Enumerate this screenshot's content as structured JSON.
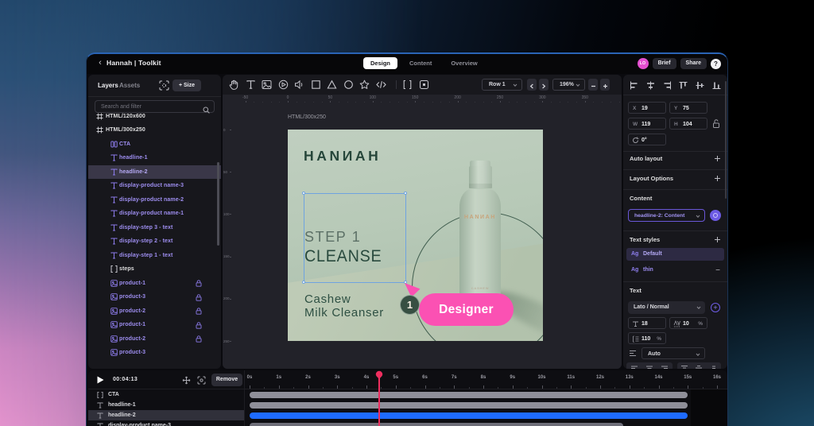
{
  "colors": {
    "accent_purple": "#8b7ae8",
    "accent_blue": "#1e6bff",
    "pink": "#fb51b3",
    "selection_blue": "#6fa3e0",
    "playhead_red": "#ee2e5f",
    "artboard_sage": "#b6c7b6",
    "deep_green": "#27473b",
    "avatar_pink": "#e44fd0"
  },
  "header": {
    "back": "‹",
    "title": "Hannah | Toolkit",
    "tabs": [
      {
        "label": "Design",
        "active": true
      },
      {
        "label": "Content",
        "active": false
      },
      {
        "label": "Overview",
        "active": false
      }
    ],
    "avatar": "LO",
    "brief": "Brief",
    "share": "Share",
    "help": "?"
  },
  "sidebar": {
    "tab_layers": "Layers",
    "tab_assets": "Assets",
    "size_button": "+ Size",
    "search_placeholder": "Search and filter",
    "layers": [
      {
        "name": "HTML/120x600",
        "icon": "frame",
        "tone": "white",
        "indent": 0,
        "selected": false,
        "locked": false
      },
      {
        "name": "HTML/300x250",
        "icon": "frame",
        "tone": "white",
        "indent": 0,
        "selected": false,
        "locked": false
      },
      {
        "name": "CTA",
        "icon": "component",
        "tone": "purple",
        "indent": 1,
        "selected": false,
        "locked": false
      },
      {
        "name": "headline-1",
        "icon": "text",
        "tone": "purple",
        "indent": 1,
        "selected": false,
        "locked": false
      },
      {
        "name": "headline-2",
        "icon": "text",
        "tone": "purple",
        "indent": 1,
        "selected": true,
        "locked": false
      },
      {
        "name": "display-product name-3",
        "icon": "text",
        "tone": "purple",
        "indent": 1,
        "selected": false,
        "locked": false
      },
      {
        "name": "display-product name-2",
        "icon": "text",
        "tone": "purple",
        "indent": 1,
        "selected": false,
        "locked": false
      },
      {
        "name": "display-product name-1",
        "icon": "text",
        "tone": "purple",
        "indent": 1,
        "selected": false,
        "locked": false
      },
      {
        "name": "display-step 3 - text",
        "icon": "text",
        "tone": "purple",
        "indent": 1,
        "selected": false,
        "locked": false
      },
      {
        "name": "display-step 2 - text",
        "icon": "text",
        "tone": "purple",
        "indent": 1,
        "selected": false,
        "locked": false
      },
      {
        "name": "display-step 1 - text",
        "icon": "text",
        "tone": "purple",
        "indent": 1,
        "selected": false,
        "locked": false
      },
      {
        "name": "steps",
        "icon": "group",
        "tone": "white",
        "indent": 1,
        "selected": false,
        "locked": false
      },
      {
        "name": "product-1",
        "icon": "image",
        "tone": "purple",
        "indent": 1,
        "selected": false,
        "locked": true
      },
      {
        "name": "product-3",
        "icon": "image",
        "tone": "purple",
        "indent": 1,
        "selected": false,
        "locked": true
      },
      {
        "name": "product-2",
        "icon": "image",
        "tone": "purple",
        "indent": 1,
        "selected": false,
        "locked": true
      },
      {
        "name": "product-1",
        "icon": "image",
        "tone": "purple",
        "indent": 1,
        "selected": false,
        "locked": true
      },
      {
        "name": "product-2",
        "icon": "image",
        "tone": "purple",
        "indent": 1,
        "selected": false,
        "locked": true
      },
      {
        "name": "product-3",
        "icon": "image",
        "tone": "purple",
        "indent": 1,
        "selected": false,
        "locked": false
      }
    ]
  },
  "canvas": {
    "tools": [
      "hand",
      "text",
      "image",
      "play",
      "audio",
      "rectangle",
      "triangle",
      "ellipse",
      "star",
      "code",
      "divider",
      "brackets",
      "embed"
    ],
    "row_select": "Row 1",
    "zoom": "196%",
    "h_ruler": [
      -50,
      0,
      50,
      100,
      150,
      200,
      250,
      300,
      350
    ],
    "v_ruler": [
      0,
      50,
      100,
      150,
      200,
      250
    ],
    "artboard_label": "HTML/300x250",
    "artboard": {
      "logo": "HANИAH",
      "step": "STEP 1",
      "headline": "CLEANSE",
      "product_line1": "Cashew",
      "product_line2": "Milk Cleanser",
      "bottle_brand": "HANИAH",
      "bottle_small": "CASHEW",
      "step_badge": "1",
      "cursor_label": "Designer"
    }
  },
  "inspector": {
    "x_label": "X",
    "x": "19",
    "y_label": "Y",
    "y": "75",
    "w_label": "W",
    "w": "119",
    "h_label": "H",
    "h": "104",
    "rotation": "0°",
    "auto_layout": "Auto layout",
    "layout_options": "Layout Options",
    "content_title": "Content",
    "content_value": "headline-2: Content",
    "text_styles_title": "Text styles",
    "styles": [
      {
        "ag": "Ag",
        "name": "Default",
        "selected": true
      },
      {
        "ag": "Ag",
        "name": "thin",
        "selected": false
      }
    ],
    "text_title": "Text",
    "font": "Lato / Normal",
    "font_size": "18",
    "letter_spacing": "10",
    "letter_spacing_unit": "%",
    "line_height": "110",
    "line_height_unit": "%",
    "text_transform": "Auto"
  },
  "timeline": {
    "time": "00:04:13",
    "remove": "Remove",
    "seconds": [
      "0s",
      "1s",
      "2s",
      "3s",
      "4s",
      "5s",
      "6s",
      "7s",
      "8s",
      "9s",
      "10s",
      "11s",
      "12s",
      "13s",
      "14s",
      "15s",
      "16s"
    ],
    "playhead_position": 4.43,
    "duration_seconds": 15,
    "tracks": [
      {
        "name": "CTA",
        "icon": "group",
        "color": "gray",
        "start": 0,
        "end": 15,
        "selected": false
      },
      {
        "name": "headline-1",
        "icon": "text",
        "color": "gray",
        "start": 0,
        "end": 15,
        "selected": false
      },
      {
        "name": "headline-2",
        "icon": "text",
        "color": "blue",
        "start": 0,
        "end": 15,
        "selected": true
      },
      {
        "name": "display-product name-3",
        "icon": "text",
        "color": "gray",
        "start": 0,
        "end": 12.8,
        "selected": false
      }
    ]
  }
}
